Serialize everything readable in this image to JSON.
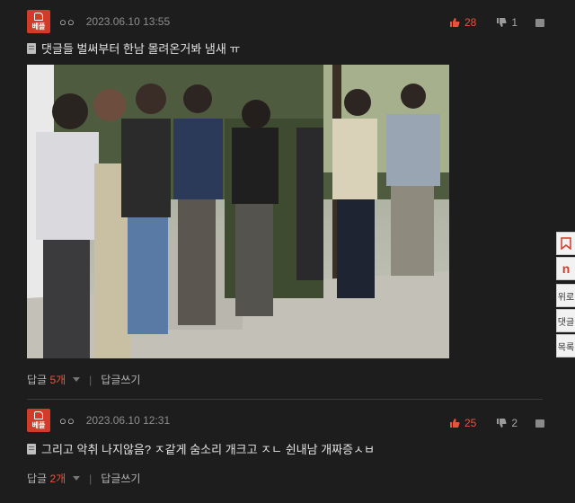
{
  "comments": [
    {
      "badge": "베플",
      "nickname": "○○",
      "date": "2023.06.10 13:55",
      "upvotes": "28",
      "downvotes": "1",
      "text": "댓글들 벌써부터 한남 몰려온거봐 냄새 ㅠ",
      "reply_label": "답글",
      "reply_count": "5개",
      "reply_write": "답글쓰기"
    },
    {
      "badge": "베플",
      "nickname": "○○",
      "date": "2023.06.10 12:31",
      "upvotes": "25",
      "downvotes": "2",
      "text": "그리고 악취 나지않음? ㅈ같게 숨소리 개크고 ㅈㄴ 쉰내남 개짜증ㅅㅂ",
      "reply_label": "답글",
      "reply_count": "2개",
      "reply_write": "답글쓰기"
    }
  ],
  "side_buttons": [
    "",
    "n",
    "위로",
    "댓글",
    "목록"
  ],
  "colors": {
    "accent": "#e4553f",
    "badge": "#d23b2a",
    "background": "#1d1d1d"
  }
}
